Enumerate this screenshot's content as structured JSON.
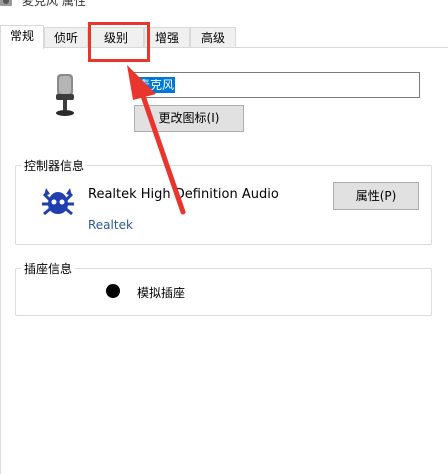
{
  "window": {
    "title": "麦克风 属性",
    "icon": "speaker-icon"
  },
  "tabs": [
    {
      "label": "常规",
      "active": true
    },
    {
      "label": "侦听",
      "active": false
    },
    {
      "label": "级别",
      "active": false
    },
    {
      "label": "增强",
      "active": false
    },
    {
      "label": "高级",
      "active": false
    }
  ],
  "general": {
    "device_icon": "microphone-icon",
    "device_name_value": "麦克风",
    "change_icon_button": "更改图标(I)"
  },
  "controller": {
    "group_label": "控制器信息",
    "icon": "realtek-crab-icon",
    "device": "Realtek High Definition Audio",
    "vendor": "Realtek",
    "properties_button": "属性(P)"
  },
  "jack": {
    "group_label": "插座信息",
    "indicator_color": "#000000",
    "label": "模拟插座"
  },
  "annotation": {
    "color": "#e8362f",
    "target": "tab-level"
  }
}
